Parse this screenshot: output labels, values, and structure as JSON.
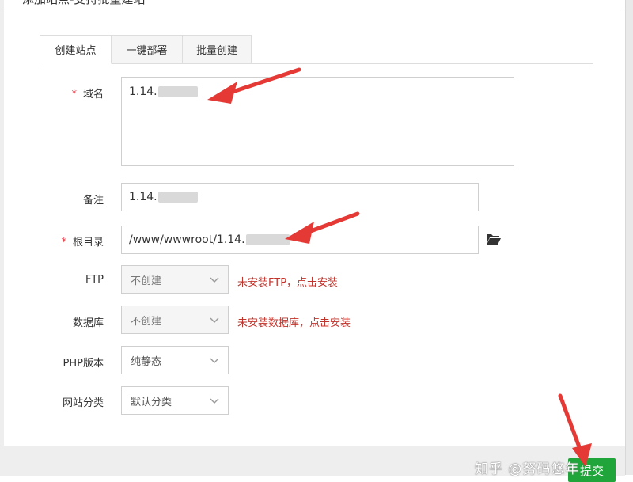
{
  "dialog": {
    "title": "添加站点-支持批量建站"
  },
  "tabs": [
    {
      "label": "创建站点"
    },
    {
      "label": "一键部署"
    },
    {
      "label": "批量创建"
    }
  ],
  "form": {
    "domain": {
      "label": "域名",
      "value": "1.14."
    },
    "remark": {
      "label": "备注",
      "value": "1.14."
    },
    "root": {
      "label": "根目录",
      "value": "/www/wwwroot/1.14."
    },
    "ftp": {
      "label": "FTP",
      "selected": "不创建",
      "hint": "未安装FTP，点击安装"
    },
    "database": {
      "label": "数据库",
      "selected": "不创建",
      "hint": "未安装数据库，点击安装"
    },
    "php": {
      "label": "PHP版本",
      "selected": "纯静态"
    },
    "category": {
      "label": "网站分类",
      "selected": "默认分类"
    }
  },
  "footer": {
    "submit_label": "提交"
  },
  "watermark": {
    "text": "知乎 @努码悠年"
  },
  "colors": {
    "required": "#e5323e",
    "hint": "#c0332b",
    "primary": "#20a53a",
    "annotation_arrow": "#e53935"
  },
  "icons": {
    "folder": "folder-open-icon",
    "chevron": "chevron-down-icon"
  }
}
